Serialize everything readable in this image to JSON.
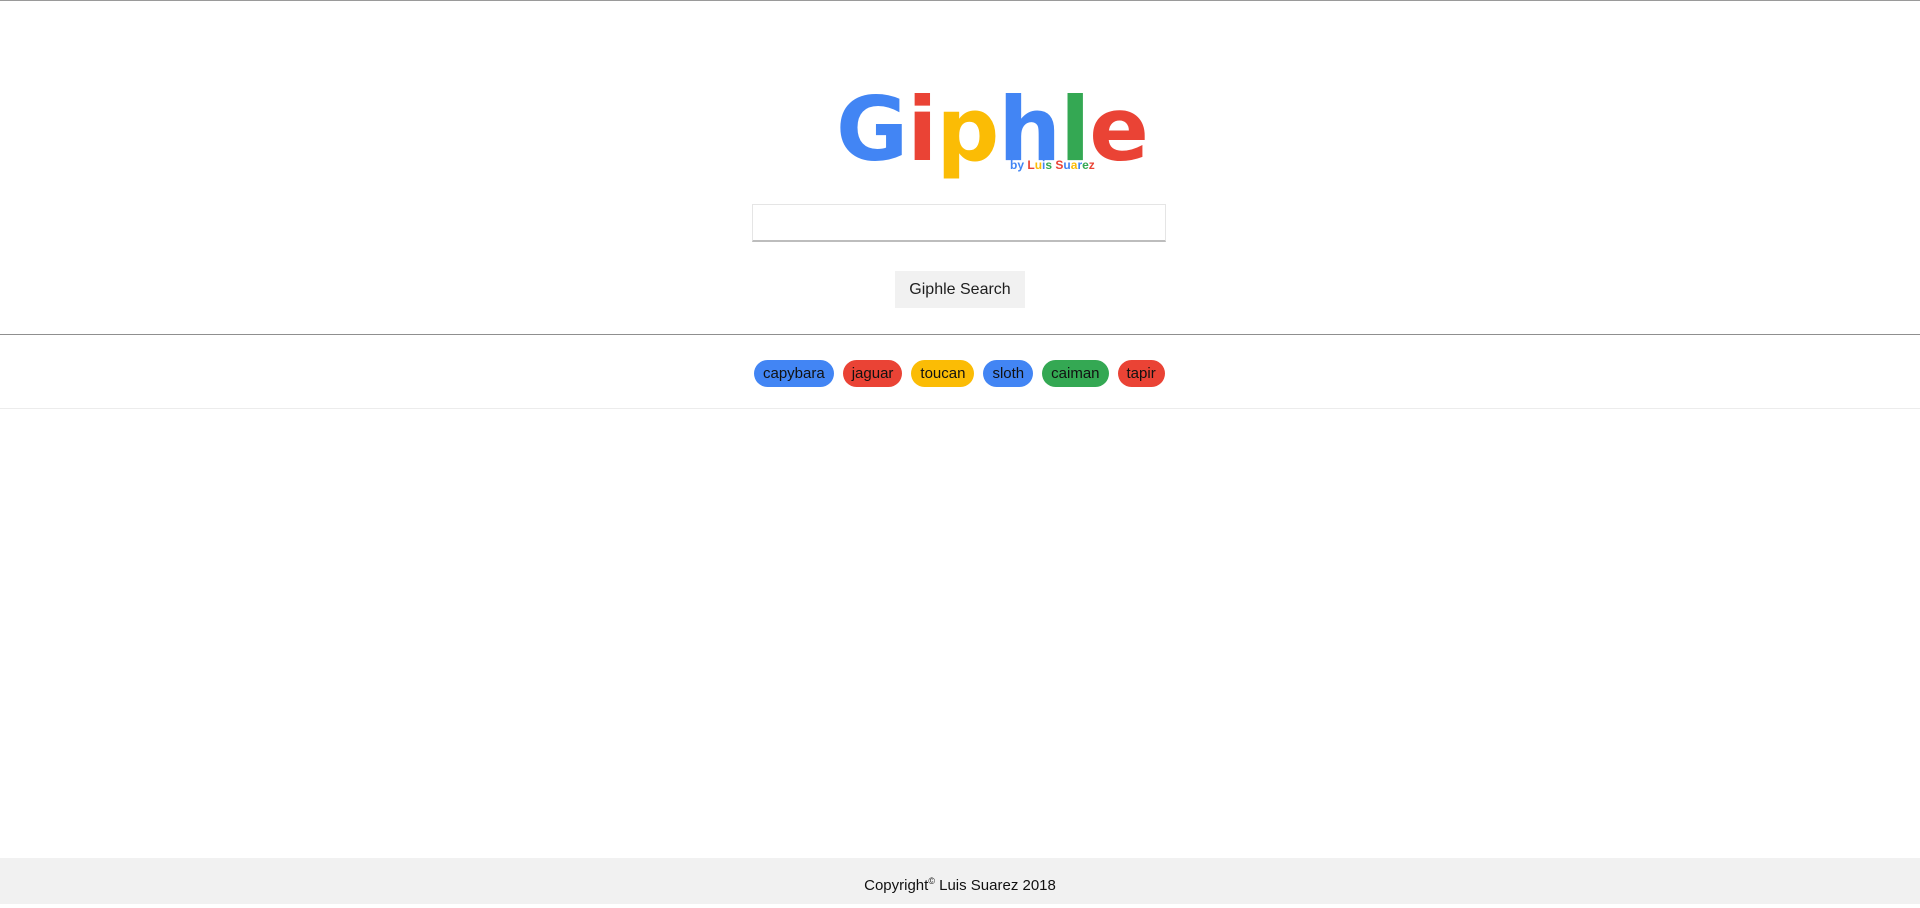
{
  "logo": {
    "letters": [
      {
        "char": "G",
        "color": "#4285F4"
      },
      {
        "char": "i",
        "color": "#EA4335"
      },
      {
        "char": "p",
        "color": "#FBBC05"
      },
      {
        "char": "h",
        "color": "#4285F4"
      },
      {
        "char": "l",
        "color": "#34A853"
      },
      {
        "char": "e",
        "color": "#EA4335"
      }
    ],
    "byline": [
      {
        "text": "by ",
        "color": "#4285F4"
      },
      {
        "text": "L",
        "color": "#EA4335"
      },
      {
        "text": "u",
        "color": "#FBBC05"
      },
      {
        "text": "i",
        "color": "#4285F4"
      },
      {
        "text": "s ",
        "color": "#34A853"
      },
      {
        "text": "S",
        "color": "#EA4335"
      },
      {
        "text": "u",
        "color": "#4285F4"
      },
      {
        "text": "a",
        "color": "#FBBC05"
      },
      {
        "text": "r",
        "color": "#4285F4"
      },
      {
        "text": "e",
        "color": "#34A853"
      },
      {
        "text": "z",
        "color": "#EA4335"
      }
    ]
  },
  "search": {
    "value": "",
    "placeholder": "",
    "button_label": "Giphle Search"
  },
  "tags": [
    {
      "label": "capybara",
      "color": "#4285F4"
    },
    {
      "label": "jaguar",
      "color": "#EA4335"
    },
    {
      "label": "toucan",
      "color": "#FBBC05"
    },
    {
      "label": "sloth",
      "color": "#4285F4"
    },
    {
      "label": "caiman",
      "color": "#34A853"
    },
    {
      "label": "tapir",
      "color": "#EA4335"
    }
  ],
  "footer": {
    "prefix": "Copyright",
    "symbol": "©",
    "suffix": " Luis Suarez 2018"
  }
}
